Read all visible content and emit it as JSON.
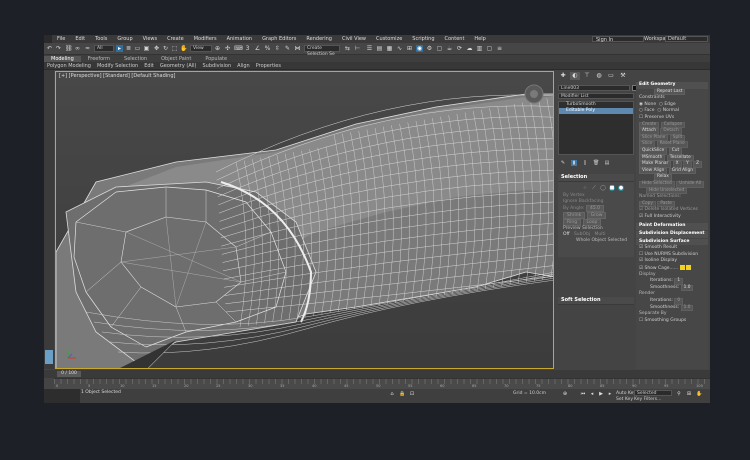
{
  "menu": [
    "File",
    "Edit",
    "Tools",
    "Group",
    "Views",
    "Create",
    "Modifiers",
    "Animation",
    "Graph Editors",
    "Rendering",
    "Civil View",
    "Customize",
    "Scripting",
    "Content",
    "Help"
  ],
  "signin": "Sign In",
  "workspaces_label": "Workspaces:",
  "workspace_value": "Default",
  "toolbar": {
    "filter_value": "All",
    "view_value": "View",
    "selset_value": "Create Selection Se"
  },
  "ribbon_tabs": [
    "Modeling",
    "Freeform",
    "Selection",
    "Object Paint",
    "Populate"
  ],
  "ribbon_row": [
    "Polygon Modeling",
    "Modify Selection",
    "Edit",
    "Geometry (All)",
    "Subdivision",
    "Align",
    "Properties"
  ],
  "viewport_label": "[+] [Perspective] [Standard] [Default Shading]",
  "command_panel": {
    "object_name": "Line003",
    "modifier_list": "Modifier List",
    "stack": [
      "TurboSmooth",
      "Editable Poly"
    ],
    "stack_selected": 1,
    "selection_header": "Selection",
    "selection_items": [
      "By Vertex",
      "Ignore Backfacing",
      "By Angle:",
      "45.0",
      "Shrink",
      "Grow",
      "Ring",
      "Loop"
    ],
    "preview_selection": "Preview Selection",
    "preview_options": [
      "Off",
      "SubObj",
      "Multi"
    ],
    "whole_object": "Whole Object Selected",
    "soft_selection_header": "Soft Selection",
    "swatch_color": "#111111"
  },
  "edit_geometry": {
    "header": "Edit Geometry",
    "repeat_last": "Repeat Last",
    "constraints": "Constraints",
    "constraint_options": [
      "None",
      "Edge",
      "Face",
      "Normal"
    ],
    "preserve_uvs": "Preserve UVs",
    "buttons": [
      "Create",
      "Collapse",
      "Attach",
      "Detach",
      "Slice Plane",
      "Split",
      "Slice",
      "Reset Plane",
      "QuickSlice",
      "Cut",
      "MSmooth",
      "Tessellate",
      "Make Planar",
      "X",
      "Y",
      "Z",
      "View Align",
      "Grid Align",
      "Relax",
      "Hide Selected",
      "Unhide All",
      "Hide Unselected"
    ],
    "named_selections": "Named Selections:",
    "copy": "Copy",
    "paste": "Paste",
    "delete_isolated": "Delete Isolated Vertices",
    "full_interactivity": "Full Interactivity"
  },
  "rollouts": [
    "Paint Deformation",
    "Subdivision Displacement",
    "Subdivision Surface"
  ],
  "subdivision_surface": {
    "smooth_result": "Smooth Result",
    "use_nurms": "Use NURMS Subdivision",
    "isoline": "Isoline Display",
    "show_cage": "Show Cage......",
    "display_label": "Display",
    "iterations_label": "Iterations:",
    "iterations_value": "1",
    "smoothness_label": "Smoothness:",
    "smoothness_value": "1.0",
    "render_label": "Render",
    "render_iterations_label": "Iterations:",
    "render_iterations_value": "0",
    "render_smoothness_label": "Smoothness:",
    "render_smoothness_value": "1.0",
    "separate_by": "Separate By",
    "smoothing_groups": "Smoothing Groups",
    "cage_colors": [
      "#f2d21b",
      "#f2d21b"
    ]
  },
  "time_slider": "0 / 100",
  "trackbar_ticks": [
    "0",
    "5",
    "10",
    "15",
    "20",
    "25",
    "30",
    "35",
    "40",
    "45",
    "50",
    "55",
    "60",
    "65",
    "70",
    "75",
    "80",
    "85",
    "90",
    "95",
    "100"
  ],
  "status": {
    "message": "1 Object Selected",
    "grid": "Grid = 10.0cm",
    "auto_key": "Auto Key",
    "selected": "Selected",
    "set_key": "Set Key",
    "key_filters": "Key Filters..."
  }
}
